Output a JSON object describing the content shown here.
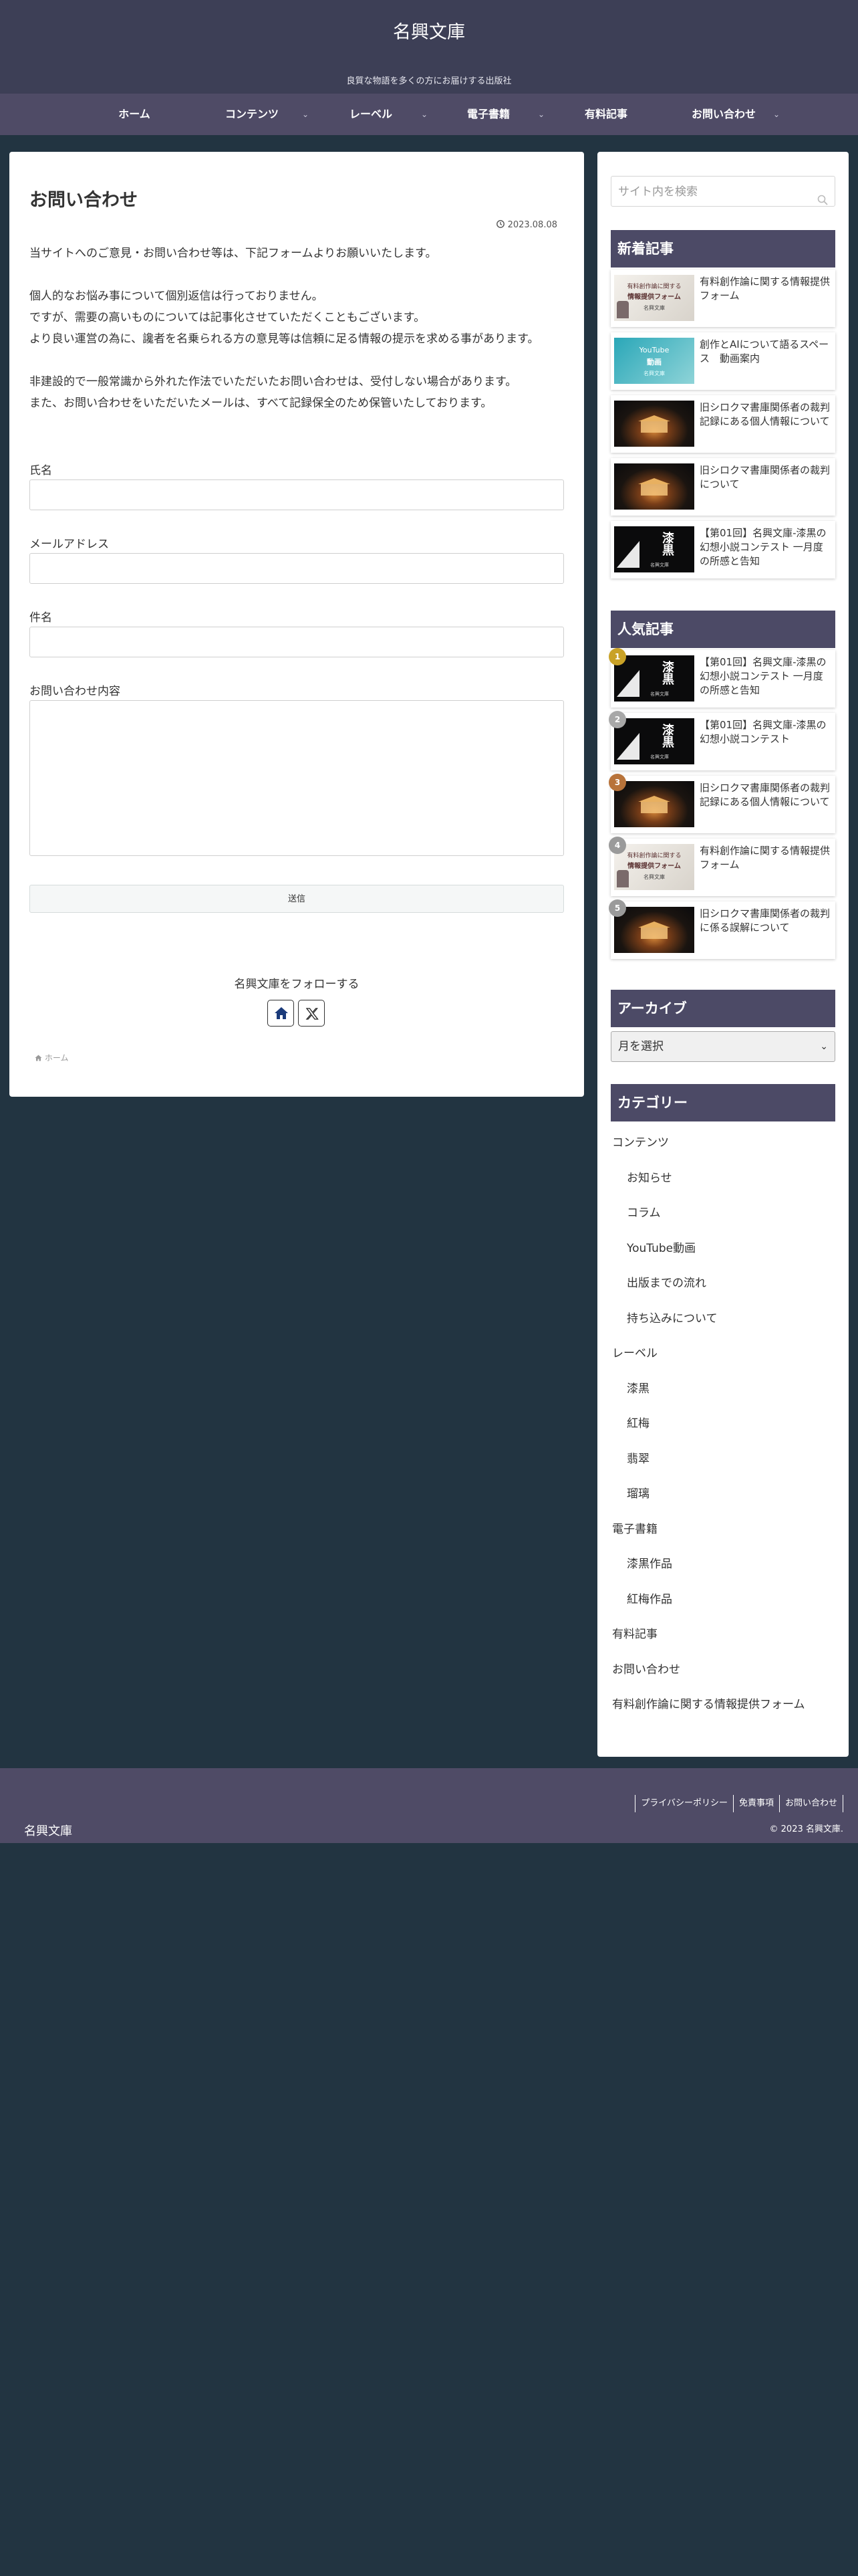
{
  "site": {
    "title": "名興文庫",
    "tagline": "良質な物語を多くの方にお届けする出版社"
  },
  "nav": [
    {
      "label": "ホーム"
    },
    {
      "label": "コンテンツ"
    },
    {
      "label": "レーベル"
    },
    {
      "label": "電子書籍"
    },
    {
      "label": "有料記事"
    },
    {
      "label": "お問い合わせ"
    }
  ],
  "page": {
    "title": "お問い合わせ",
    "date": "2023.08.08",
    "intro": [
      "当サイトへのご意見・お問い合わせ等は、下記フォームよりお願いいたします。",
      "",
      "個人的なお悩み事について個別返信は行っておりません。",
      "ですが、需要の高いものについては記事化させていただくこともございます。",
      "より良い運営の為に、讒者を名乗られる方の意見等は信頼に足る情報の提示を求める事があります。",
      "",
      "非建設的で一般常識から外れた作法でいただいたお問い合わせは、受付しない場合があります。",
      "また、お問い合わせをいただいたメールは、すべて記録保全のため保管いたしております。"
    ]
  },
  "form": {
    "name_label": "氏名",
    "email_label": "メールアドレス",
    "subject_label": "件名",
    "message_label": "お問い合わせ内容",
    "submit_label": "送信"
  },
  "follow": {
    "label": "名興文庫をフォローする"
  },
  "breadcrumb": {
    "home": "ホーム"
  },
  "sidebar": {
    "search_placeholder": "サイト内を検索",
    "recent_title": "新着記事",
    "recent": [
      {
        "title": "有料創作論に関する情報提供フォーム",
        "thumb": "form"
      },
      {
        "title": "創作とAIについて語るスペース　動画案内",
        "thumb": "youtube"
      },
      {
        "title": "旧シロクマ書庫関係者の裁判記録にある個人情報について",
        "thumb": "court"
      },
      {
        "title": "旧シロクマ書庫関係者の裁判について",
        "thumb": "court"
      },
      {
        "title": "【第01回】名興文庫-漆黒の幻想小説コンテスト 一月度の所感と告知",
        "thumb": "book"
      }
    ],
    "popular_title": "人気記事",
    "popular": [
      {
        "rank": "1",
        "title": "【第01回】名興文庫-漆黒の幻想小説コンテスト 一月度の所感と告知",
        "thumb": "book"
      },
      {
        "rank": "2",
        "title": "【第01回】名興文庫-漆黒の幻想小説コンテスト",
        "thumb": "book"
      },
      {
        "rank": "3",
        "title": "旧シロクマ書庫関係者の裁判記録にある個人情報について",
        "thumb": "court"
      },
      {
        "rank": "4",
        "title": "有料創作論に関する情報提供フォーム",
        "thumb": "form"
      },
      {
        "rank": "5",
        "title": "旧シロクマ書庫関係者の裁判に係る誤解について",
        "thumb": "court"
      }
    ],
    "thumb_text": {
      "form_line1": "有料創作論に関する",
      "form_line2": "情報提供フォーム",
      "form_brand": "名興文庫",
      "yt_line1": "YouTube",
      "yt_line2": "動画",
      "yt_brand": "名興文庫",
      "book_kanji": "漆黒",
      "book_sub": "名興文庫"
    },
    "archive_title": "アーカイブ",
    "archive_select": "月を選択",
    "category_title": "カテゴリー",
    "categories": [
      {
        "label": "コンテンツ",
        "indent": false
      },
      {
        "label": "お知らせ",
        "indent": true
      },
      {
        "label": "コラム",
        "indent": true
      },
      {
        "label": "YouTube動画",
        "indent": true
      },
      {
        "label": "出版までの流れ",
        "indent": true
      },
      {
        "label": "持ち込みについて",
        "indent": true
      },
      {
        "label": "レーベル",
        "indent": false
      },
      {
        "label": "漆黒",
        "indent": true
      },
      {
        "label": "紅梅",
        "indent": true
      },
      {
        "label": "翡翠",
        "indent": true
      },
      {
        "label": "瑠璃",
        "indent": true
      },
      {
        "label": "電子書籍",
        "indent": false
      },
      {
        "label": "漆黒作品",
        "indent": true
      },
      {
        "label": "紅梅作品",
        "indent": true
      },
      {
        "label": "有料記事",
        "indent": false
      },
      {
        "label": "お問い合わせ",
        "indent": false
      },
      {
        "label": "有料創作論に関する情報提供フォーム",
        "indent": false
      }
    ]
  },
  "footer": {
    "name": "名興文庫",
    "links": [
      "プライバシーポリシー",
      "免責事項",
      "お問い合わせ"
    ],
    "copyright": "© 2023 名興文庫."
  },
  "colors": {
    "header": "#3d3f56",
    "nav": "#4f4b66",
    "widget_title": "#4c4a66",
    "background": "#223441",
    "rank_gold": "#c9a227",
    "rank_silver": "#a8a8a8",
    "rank_bronze": "#b8733a",
    "rank_other": "#9a9a9a"
  }
}
